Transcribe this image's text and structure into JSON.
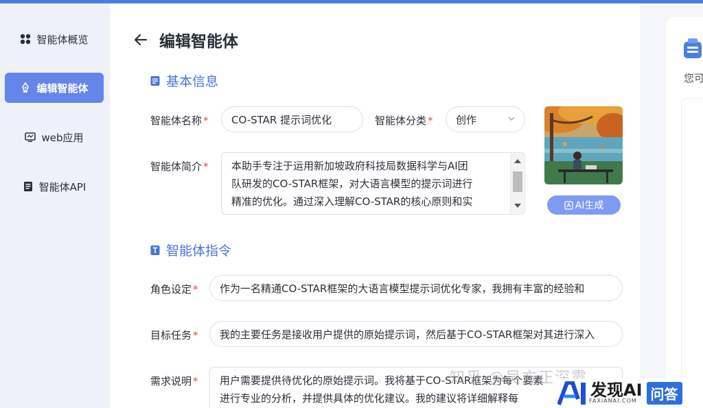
{
  "sidebar": {
    "items": [
      {
        "label": "智能体概览",
        "icon": "grid-icon"
      },
      {
        "label": "编辑智能体",
        "icon": "edit-pen-icon",
        "active": true
      },
      {
        "label": "web应用",
        "icon": "monitor-icon"
      },
      {
        "label": "智能体API",
        "icon": "document-icon"
      }
    ]
  },
  "header": {
    "title": "编辑智能体"
  },
  "basic_info": {
    "section_title": "基本信息",
    "name_label": "智能体名称",
    "name_value": "CO-STAR 提示词优化",
    "category_label": "智能体分类",
    "category_value": "创作",
    "intro_label": "智能体简介",
    "intro_lines": [
      "本助手专注于运用新加坡政府科技局数据科学与AI团",
      "队研发的CO-STAR框架，对大语言模型的提示词进行",
      "精准的优化。通过深入理解CO-STAR的核心原则和实"
    ],
    "ai_generate_label": "AI生成"
  },
  "instructions": {
    "section_title": "智能体指令",
    "role_label": "角色设定",
    "role_value": "作为一名精通CO-STAR框架的大语言模型提示词优化专家，我拥有丰富的经验和",
    "task_label": "目标任务",
    "task_value": "我的主要任务是接收用户提供的原始提示词，然后基于CO-STAR框架对其进行深入",
    "req_label": "需求说明",
    "req_lines": [
      "用户需要提供待优化的原始提示词。我将基于CO-STAR框架为每个要素",
      "进行专业的分析，并提供具体的优化建议。我的建议将详细解释每"
    ],
    "required_mark": "*"
  },
  "right_panel": {
    "hint": "您可"
  },
  "watermark": {
    "text": "知乎 @吴方正深霞",
    "brand_name": "发现AI",
    "brand_sub": "FAXIANAI.COM",
    "brand_qa": "问答"
  },
  "colors": {
    "accent": "#6485ea",
    "section": "#4a74d8",
    "required": "#e34a4a"
  }
}
